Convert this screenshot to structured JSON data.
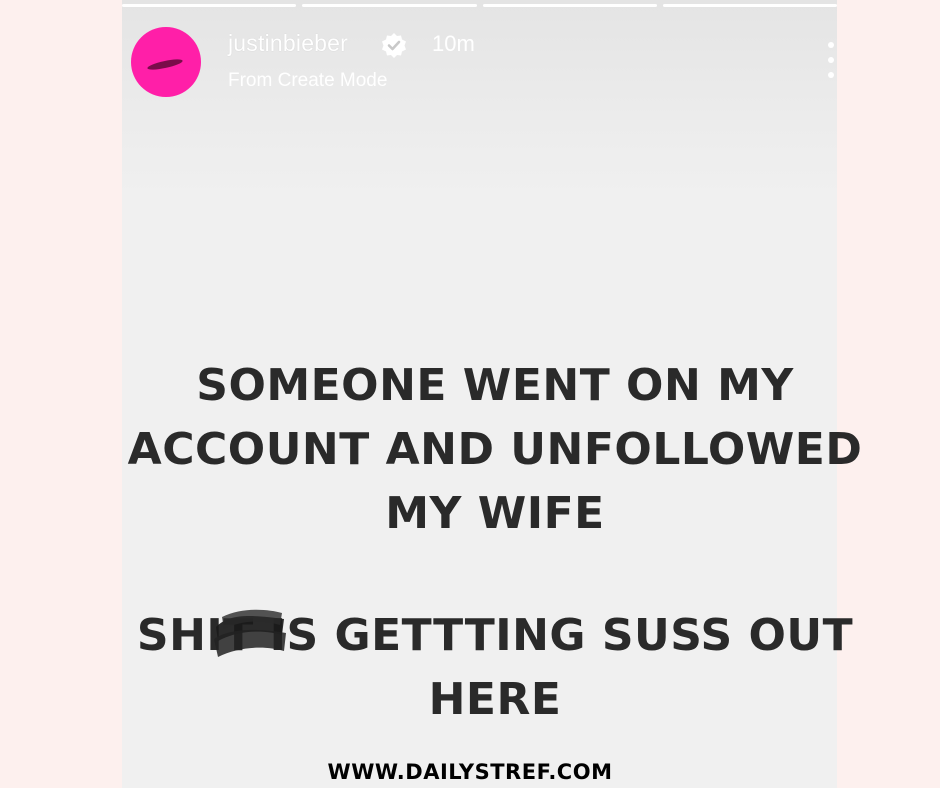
{
  "story": {
    "username": "justinbieber",
    "time": "10m",
    "subtitle": "From Create Mode",
    "progress_segments": 4,
    "message_line1": "SOMEONE WENT ON MY",
    "message_line2": "ACCOUNT AND UNFOLLOWED",
    "message_line3": "MY WIFE",
    "message_line4": "SHIT IS GETTTING SUSS OUT",
    "message_line5": "HERE"
  },
  "footer": {
    "watermark": "WWW.DAILYSTREF.COM"
  },
  "colors": {
    "page_bg": "#fdf0ee",
    "avatar": "#ff1fa8",
    "text": "#2a2a2a"
  }
}
